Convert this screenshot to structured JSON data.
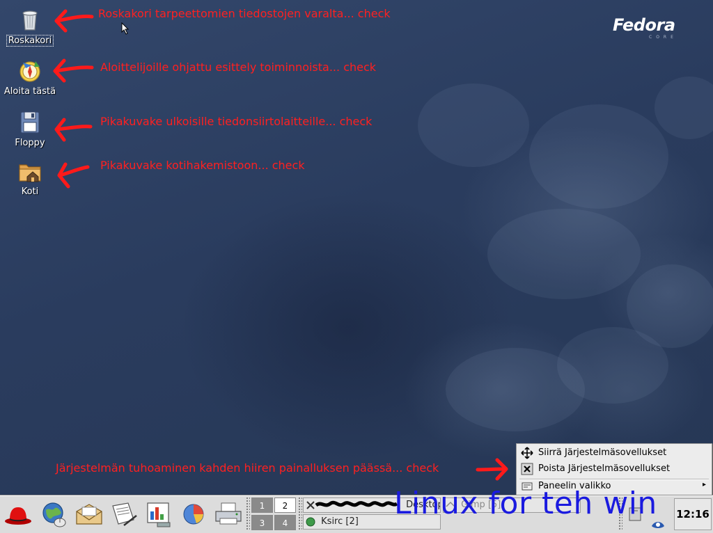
{
  "desktop": {
    "logo": {
      "word": "Fedora",
      "sub": "CORE"
    },
    "icons": [
      {
        "label": "Roskakori"
      },
      {
        "label": "Aloita tästä"
      },
      {
        "label": "Floppy"
      },
      {
        "label": "Koti"
      }
    ]
  },
  "annotations": {
    "trash": "Roskakori tarpeettomien tiedostojen varalta... check",
    "start": "Aloittelijoille ohjattu esittely toiminnoista... check",
    "floppy": "Pikakuvake ulkoisille tiedonsiirtolaitteille... check",
    "home": "Pikakuvake kotihakemistoon... check",
    "destroy": "Järjestelmän tuhoaminen kahden hiiren painalluksen päässä... check",
    "overlay": "Linux for teh win"
  },
  "context_menu": {
    "items": [
      {
        "label": "Siirrä Järjestelmäsovellukset",
        "icon": "move-icon"
      },
      {
        "label": "Poista Järjestelmäsovellukset",
        "icon": "close-icon"
      },
      {
        "label": "Paneelin valikko",
        "icon": "panel-icon",
        "submenu_arrow": "▸"
      }
    ]
  },
  "panel": {
    "workspaces": [
      "1",
      "2",
      "3",
      "4"
    ],
    "active_workspace": "2",
    "tasks": [
      {
        "label": "Desktop"
      },
      {
        "label": "Gimp [5]"
      },
      {
        "label": "Ksirc [2]"
      }
    ],
    "clock": "12:16"
  },
  "colors": {
    "annotation": "#ff2020",
    "overlay_text": "#1a1adf",
    "desktop_bg": "#2a3c5e",
    "panel_bg": "#dcdcdc"
  }
}
